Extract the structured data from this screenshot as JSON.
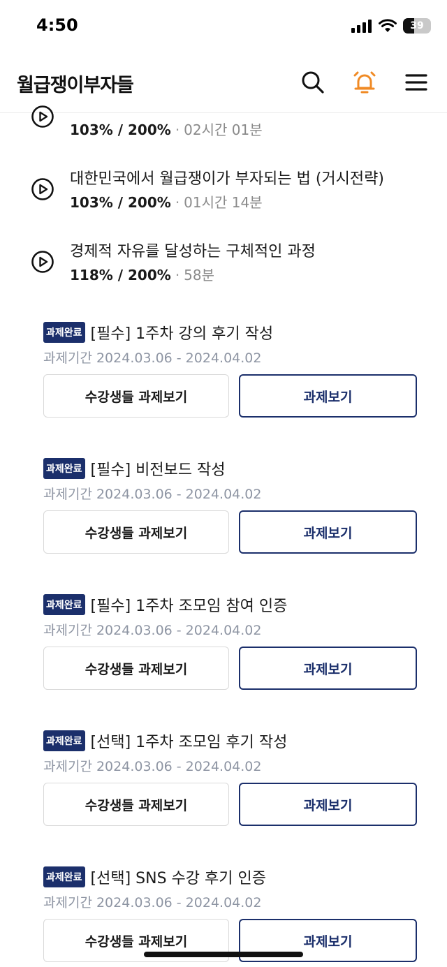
{
  "status_bar": {
    "time": "4:50",
    "battery": "39",
    "battery_level": 0.39
  },
  "header": {
    "title": "월급쟁이부자들",
    "icons": [
      "search-icon",
      "bell-icon",
      "menu-icon"
    ],
    "accent_color": "#f08a24"
  },
  "lectures": [
    {
      "title": "",
      "progress": "103% / 200%",
      "duration": "02시간 01분"
    },
    {
      "title": "대한민국에서 월급쟁이가 부자되는 법 (거시전략)",
      "progress": "103% / 200%",
      "duration": "01시간 14분"
    },
    {
      "title": "경제적 자유를 달성하는 구체적인 과정",
      "progress": "118% / 200%",
      "duration": "58분"
    }
  ],
  "assignments": [
    {
      "badge": "과제완료",
      "title": "[필수] 1주차 강의 후기 작성",
      "period": "과제기간 2024.03.06 - 2024.04.02",
      "students_button": "수강생들 과제보기",
      "view_button": "과제보기"
    },
    {
      "badge": "과제완료",
      "title": "[필수] 비전보드 작성",
      "period": "과제기간 2024.03.06 - 2024.04.02",
      "students_button": "수강생들 과제보기",
      "view_button": "과제보기"
    },
    {
      "badge": "과제완료",
      "title": "[필수] 1주차 조모임 참여 인증",
      "period": "과제기간 2024.03.06 - 2024.04.02",
      "students_button": "수강생들 과제보기",
      "view_button": "과제보기"
    },
    {
      "badge": "과제완료",
      "title": "[선택] 1주차 조모임 후기 작성",
      "period": "과제기간 2024.03.06 - 2024.04.02",
      "students_button": "수강생들 과제보기",
      "view_button": "과제보기"
    },
    {
      "badge": "과제완료",
      "title": "[선택] SNS 수강 후기 인증",
      "period": "과제기간 2024.03.06 - 2024.04.02",
      "students_button": "수강생들 과제보기",
      "view_button": "과제보기"
    }
  ],
  "colors": {
    "badge": "#1b2f6b",
    "period_text": "#8e95a3"
  }
}
